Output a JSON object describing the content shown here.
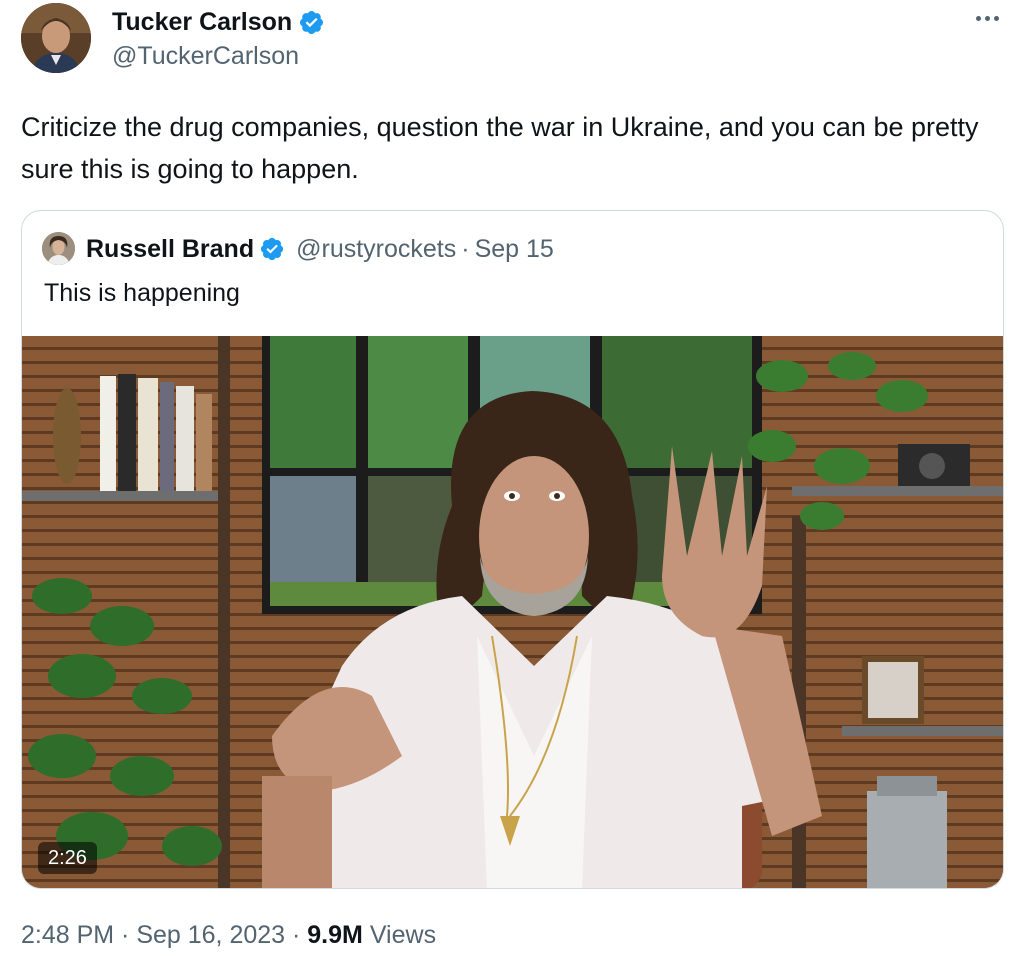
{
  "tweet": {
    "author": {
      "name": "Tucker Carlson",
      "handle": "@TuckerCarlson",
      "verified": true
    },
    "text": "Criticize the drug companies, question the war in Ukraine, and you can be pretty sure this is going to happen.",
    "timestamp": "2:48 PM · Sep 16, 2023",
    "meta_sep": " · ",
    "views_count": "9.9M",
    "views_label": "Views"
  },
  "quote": {
    "author": {
      "name": "Russell Brand",
      "handle": "@rustyrockets",
      "verified": true
    },
    "separator": "·",
    "date": "Sep 15",
    "text": "This is happening",
    "video": {
      "duration": "2:26"
    }
  },
  "colors": {
    "verified_badge": "#1d9bf0",
    "secondary_text": "#536471",
    "primary_text": "#0f1419",
    "card_border": "#cfd9de"
  },
  "icons": {
    "more": "more-horizontal-icon",
    "verified": "verified-badge-icon"
  }
}
